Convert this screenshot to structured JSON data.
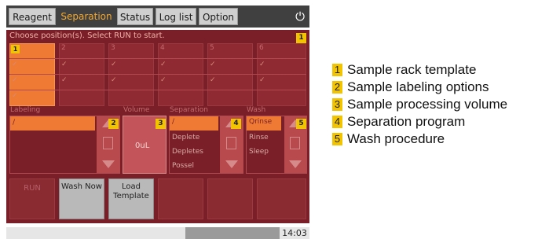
{
  "tabs": [
    "Reagent",
    "Separation",
    "Status",
    "Log list",
    "Option"
  ],
  "power_icon": "power-icon",
  "instruction": "Choose position(s). Select RUN to start.",
  "positions": [
    "1",
    "2",
    "3",
    "4",
    "5",
    "6"
  ],
  "sections": {
    "labeling": "Labeling",
    "volume": "Volume",
    "separation": "Separation",
    "wash": "Wash"
  },
  "volume_value": "0uL",
  "separation_items": [
    "/",
    "Deplete",
    "Depletes",
    "Possel"
  ],
  "wash_items": [
    "Qrinse",
    "Rinse",
    "Sleep"
  ],
  "labeling_value": "/",
  "bottom_buttons": [
    {
      "label": "RUN",
      "enabled": false
    },
    {
      "label": "Wash Now",
      "enabled": true
    },
    {
      "label": "Load Template",
      "enabled": true
    },
    {
      "label": "",
      "enabled": false
    },
    {
      "label": "",
      "enabled": false
    },
    {
      "label": "",
      "enabled": false
    }
  ],
  "clock": "14:03",
  "callouts": [
    "1",
    "2",
    "3",
    "4",
    "5"
  ],
  "legend": [
    {
      "num": "1",
      "text": "Sample rack template"
    },
    {
      "num": "2",
      "text": "Sample labeling options"
    },
    {
      "num": "3",
      "text": "Sample processing volume"
    },
    {
      "num": "4",
      "text": "Separation program"
    },
    {
      "num": "5",
      "text": "Wash procedure"
    }
  ],
  "colors": {
    "panel": "#7a1f27",
    "selected": "#ee7a34",
    "active_tab_text": "#f2a830",
    "badge": "#f2c400"
  }
}
